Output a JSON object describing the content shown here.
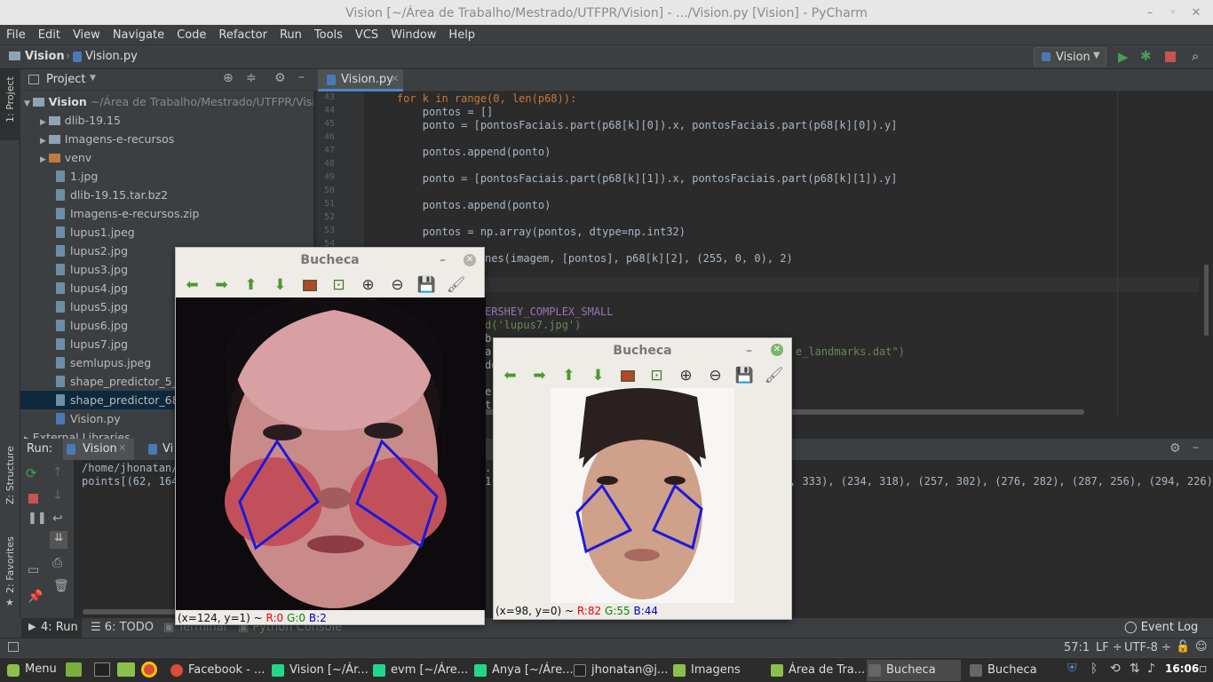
{
  "window": {
    "title": "Vision [~/Área de Trabalho/Mestrado/UTFPR/Vision] - .../Vision.py [Vision] - PyCharm"
  },
  "menu": [
    "File",
    "Edit",
    "View",
    "Navigate",
    "Code",
    "Refactor",
    "Run",
    "Tools",
    "VCS",
    "Window",
    "Help"
  ],
  "breadcrumb": {
    "project": "Vision",
    "file": "Vision.py"
  },
  "run_config": "Vision",
  "side_tabs": {
    "project": "1: Project",
    "structure": "Z: Structure",
    "favorites": "2: Favorites"
  },
  "project_panel": {
    "title": "Project",
    "root": "Vision",
    "root_path": "~/Área de Trabalho/Mestrado/UTFPR/Vision",
    "items": [
      "dlib-19.15",
      "Imagens-e-recursos",
      "venv",
      "1.jpg",
      "dlib-19.15.tar.bz2",
      "Imagens-e-recursos.zip",
      "lupus1.jpeg",
      "lupus2.jpg",
      "lupus3.jpg",
      "lupus4.jpg",
      "lupus5.jpg",
      "lupus6.jpg",
      "lupus7.jpg",
      "semlupus.jpeg",
      "shape_predictor_5_fa",
      "shape_predictor_68_f",
      "Vision.py",
      "External Libraries"
    ]
  },
  "editor": {
    "tab": "Vision.py",
    "lines": [
      {
        "n": "43",
        "t": "    for k in range(0, len(p68)):"
      },
      {
        "n": "44",
        "t": "        pontos = []"
      },
      {
        "n": "45",
        "t": "        ponto = [pontosFaciais.part(p68[k][0]).x, pontosFaciais.part(p68[k][0]).y]"
      },
      {
        "n": "46",
        "t": ""
      },
      {
        "n": "47",
        "t": "        pontos.append(ponto)"
      },
      {
        "n": "48",
        "t": ""
      },
      {
        "n": "49",
        "t": "        ponto = [pontosFaciais.part(p68[k][1]).x, pontosFaciais.part(p68[k][1]).y]"
      },
      {
        "n": "50",
        "t": ""
      },
      {
        "n": "51",
        "t": "        pontos.append(ponto)"
      },
      {
        "n": "52",
        "t": ""
      },
      {
        "n": "53",
        "t": "        pontos = np.array(pontos, dtype=np.int32)"
      },
      {
        "n": "54",
        "t": ""
      }
    ],
    "partial": [
      "nes(imagem, [pontos], p68[k][2], (255, 0, 0), 2)",
      "ERSHEY_COMPLEX_SMALL",
      "d('lupus7.jpg')",
      "b",
      "a:",
      "do",
      "e",
      "t"
    ],
    "partial_right": "e_landmarks.dat\")"
  },
  "run_panel": {
    "label": "Run:",
    "tabs": [
      "Vision",
      "Vi"
    ],
    "line1": "/home/jhonatan/",
    "line2": "points[(62, 164",
    "line2_right": ", 333), (234, 318), (257, 302), (276, 282), (287, 256), (294, 226),"
  },
  "bottom_tabs": [
    "4: Run",
    "6: TODO",
    "Terminal",
    "Python Console"
  ],
  "event_log": "Event Log",
  "status": {
    "position": "57:1",
    "line_sep": "LF ÷",
    "encoding": "UTF-8 ÷"
  },
  "cv_windows": [
    {
      "title": "Bucheca",
      "status_xy": "(x=124, y=1) ~",
      "r": "R:0",
      "g": "G:0",
      "b": "B:2"
    },
    {
      "title": "Bucheca",
      "status_xy": "(x=98, y=0) ~",
      "r": "R:82",
      "g": "G:55",
      "b": "B:44"
    }
  ],
  "taskbar": {
    "menu": "Menu",
    "items": [
      "Facebook - ...",
      "Vision [~/Ár...",
      "evm [~/Áre...",
      "Anya [~/Áre...",
      "jhonatan@j...",
      "Imagens",
      "Área de Tra...",
      "Bucheca",
      "Bucheca"
    ],
    "clock": "16:06"
  },
  "colors": {
    "accent_green": "#499c54",
    "stop_red": "#c75450",
    "keyword": "#cc7832",
    "string": "#6a8759",
    "param": "#aa4926",
    "cv_blue": "#1a1adc"
  }
}
